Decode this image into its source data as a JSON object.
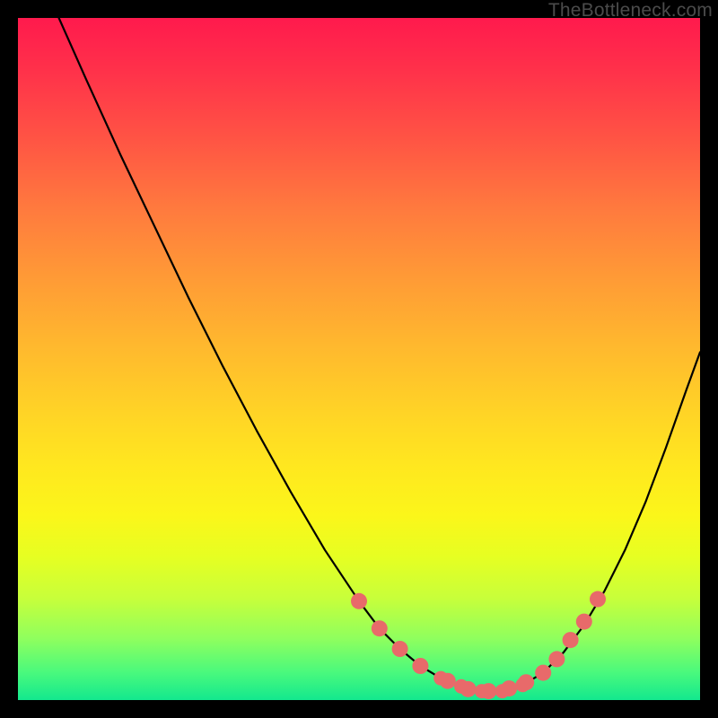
{
  "watermark": "TheBottleneck.com",
  "chart_data": {
    "type": "line",
    "title": "",
    "xlabel": "",
    "ylabel": "",
    "xlim": [
      0,
      100
    ],
    "ylim": [
      0,
      100
    ],
    "series": [
      {
        "name": "curve",
        "x": [
          6,
          10,
          15,
          20,
          25,
          30,
          35,
          40,
          45,
          50,
          53,
          56,
          59,
          62,
          65,
          68,
          71,
          74,
          77,
          80,
          83,
          86,
          89,
          92,
          95,
          98,
          100
        ],
        "y": [
          100,
          91,
          80,
          69.5,
          59,
          49,
          39.5,
          30.5,
          22,
          14.5,
          10.5,
          7.5,
          5,
          3.2,
          2,
          1.3,
          1.3,
          2.2,
          4,
          7,
          11,
          16,
          22,
          29,
          37,
          45.5,
          51
        ]
      }
    ],
    "markers": {
      "name": "highlight-points",
      "x": [
        50,
        53,
        56,
        59,
        63,
        66,
        69,
        72,
        74.5,
        77,
        79,
        81,
        83,
        85
      ],
      "y": [
        14.5,
        10.5,
        7.5,
        5,
        2.8,
        1.6,
        1.3,
        1.7,
        2.6,
        4,
        6,
        8.8,
        11.5,
        14.8
      ]
    },
    "inner_markers": {
      "name": "highlight-points-inner",
      "x": [
        62,
        65,
        68,
        71,
        74,
        77
      ],
      "y": [
        3.2,
        2,
        1.3,
        1.3,
        2.2,
        4
      ]
    },
    "colors": {
      "curve": "#000000",
      "marker_fill": "#e86a6a",
      "marker_stroke": "#c44d4d"
    }
  }
}
